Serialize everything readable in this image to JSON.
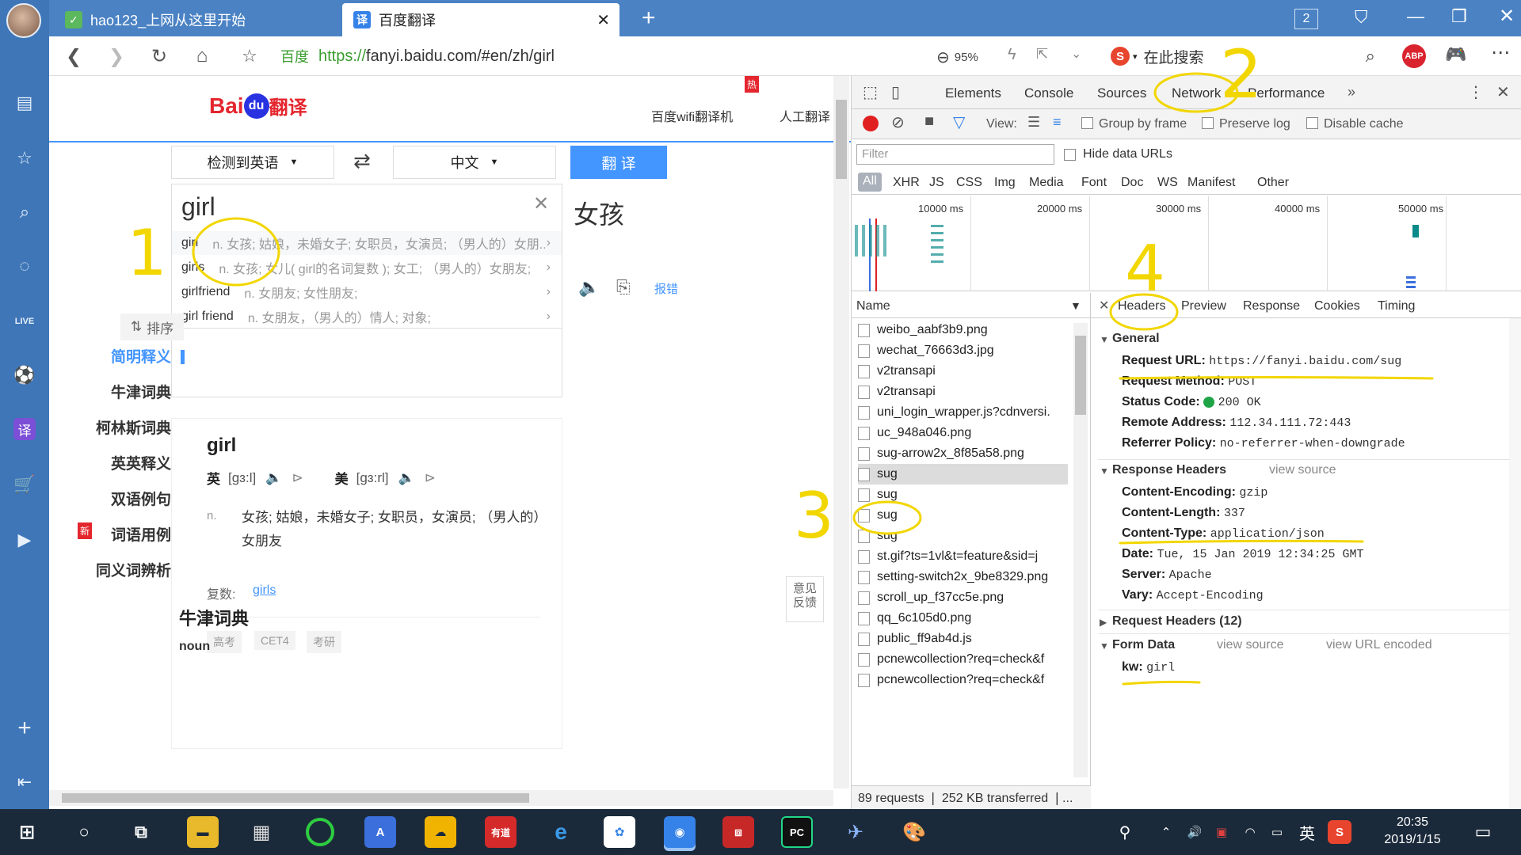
{
  "browser": {
    "tabs": [
      {
        "label": "hao123_上网从这里开始",
        "active": false
      },
      {
        "label": "百度翻译",
        "active": true
      }
    ],
    "tab_count": "2",
    "url_prefix": "百度",
    "url_scheme": "https://",
    "url_rest": "fanyi.baidu.com/#en/zh/girl",
    "zoom": "95%",
    "search_placeholder": "在此搜索",
    "abp_label": "ABP"
  },
  "page": {
    "logo_text": "Bai",
    "logo_du": "du",
    "logo_suffix": "翻译",
    "top_links": [
      "百度wifi翻译机",
      "人工翻译"
    ],
    "hot_badge": "热",
    "source_lang": "检测到英语",
    "target_lang": "中文",
    "translate_button": "翻 译",
    "input_value": "girl",
    "output_text": "女孩",
    "suggestions": [
      {
        "word": "girl",
        "def": "n. 女孩; 姑娘，未婚女子; 女职员，女演员; （男人的）女朋..."
      },
      {
        "word": "girls",
        "def": "n. 女孩; 女儿( girl的名词复数 ); 女工; （男人的）女朋友;"
      },
      {
        "word": "girlfriend",
        "def": "n. 女朋友; 女性朋友;"
      },
      {
        "word": "girl friend",
        "def": "n. 女朋友，（男人的）情人; 对象;"
      }
    ],
    "report_link": "报错",
    "sort_label": "排序",
    "side_nav": [
      "简明释义",
      "牛津词典",
      "柯林斯词典",
      "英英释义",
      "双语例句",
      "词语用例",
      "同义词辨析"
    ],
    "new_badge": "新",
    "entry": {
      "word": "girl",
      "uk_label": "英",
      "uk_phon": "[gɜ:l]",
      "us_label": "美",
      "us_phon": "[gɜ:rl]",
      "pos": "n.",
      "def": "女孩; 姑娘，未婚女子; 女职员，女演员; （男人的）女朋友",
      "plural_label": "复数:",
      "plural_value": "girls",
      "tags": [
        "高考",
        "CET4",
        "考研"
      ]
    },
    "oxford_heading": "牛津词典",
    "noun_cut": "noun",
    "feedback": "意见反馈"
  },
  "devtools": {
    "tabs": [
      "Elements",
      "Console",
      "Sources",
      "Network",
      "Performance"
    ],
    "active_tab": "Network",
    "view_label": "View:",
    "group_by_frame": "Group by frame",
    "preserve_log": "Preserve log",
    "disable_cache": "Disable cache",
    "filter_placeholder": "Filter",
    "hide_data_urls": "Hide data URLs",
    "types": [
      "All",
      "XHR",
      "JS",
      "CSS",
      "Img",
      "Media",
      "Font",
      "Doc",
      "WS",
      "Manifest",
      "Other"
    ],
    "timeline_ticks": [
      "10000 ms",
      "20000 ms",
      "30000 ms",
      "40000 ms",
      "50000 ms"
    ],
    "name_header": "Name",
    "requests": [
      "weibo_aabf3b9.png",
      "wechat_76663d3.jpg",
      "v2transapi",
      "v2transapi",
      "uni_login_wrapper.js?cdnversi.",
      "uc_948a046.png",
      "sug-arrow2x_8f85a58.png",
      "sug",
      "sug",
      "sug",
      "sug",
      "st.gif?ts=1vl&t=feature&sid=j",
      "setting-switch2x_9be8329.png",
      "scroll_up_f37cc5e.png",
      "qq_6c105d0.png",
      "public_ff9ab4d.js",
      "pcnewcollection?req=check&f",
      "pcnewcollection?req=check&f"
    ],
    "status_bar": "89 requests ❘ 252 KB transferred ❘...",
    "detail_tabs": [
      "Headers",
      "Preview",
      "Response",
      "Cookies",
      "Timing"
    ],
    "general_title": "General",
    "general": [
      {
        "k": "Request URL:",
        "v": "https://fanyi.baidu.com/sug"
      },
      {
        "k": "Request Method:",
        "v": "POST"
      },
      {
        "k": "Status Code:",
        "v": "200 OK"
      },
      {
        "k": "Remote Address:",
        "v": "112.34.111.72:443"
      },
      {
        "k": "Referrer Policy:",
        "v": "no-referrer-when-downgrade"
      }
    ],
    "response_headers_title": "Response Headers",
    "view_source": "view source",
    "response_headers": [
      {
        "k": "Content-Encoding:",
        "v": "gzip"
      },
      {
        "k": "Content-Length:",
        "v": "337"
      },
      {
        "k": "Content-Type:",
        "v": "application/json"
      },
      {
        "k": "Date:",
        "v": "Tue, 15 Jan 2019 12:34:25 GMT"
      },
      {
        "k": "Server:",
        "v": "Apache"
      },
      {
        "k": "Vary:",
        "v": "Accept-Encoding"
      }
    ],
    "request_headers_title": "Request Headers (12)",
    "form_data_title": "Form Data",
    "view_url_encoded": "view URL encoded",
    "form_data": [
      {
        "k": "kw:",
        "v": "girl"
      }
    ]
  },
  "annotations": [
    "1",
    "2",
    "3",
    "4"
  ],
  "taskbar": {
    "time": "20:35",
    "date": "2019/1/15",
    "ime": "英"
  },
  "colors": {
    "rail": "#3e76b8",
    "accent": "#4395ff",
    "annotation": "#f2d600",
    "record": "#e02020"
  }
}
